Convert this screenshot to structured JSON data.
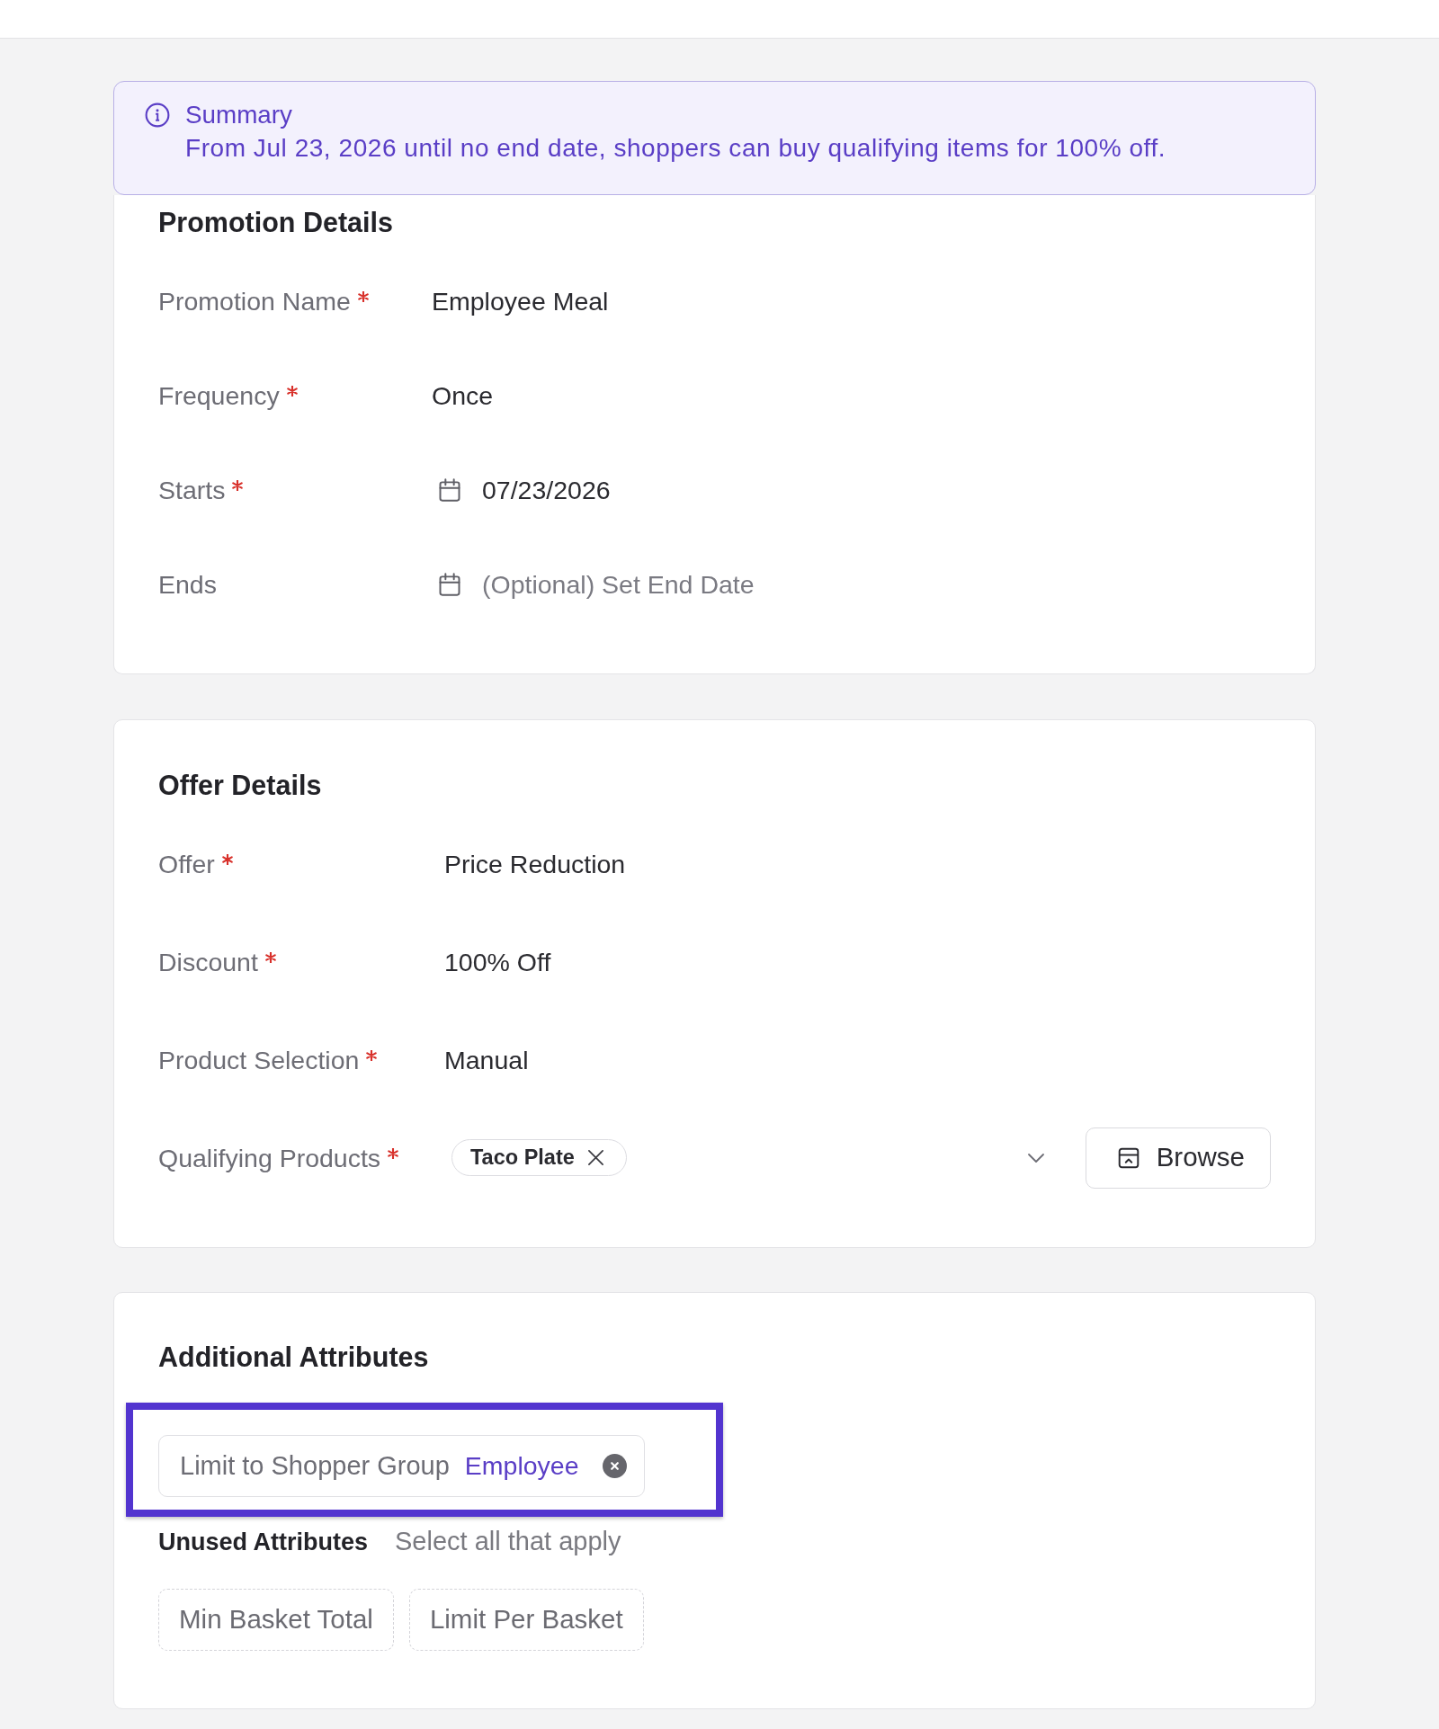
{
  "summary": {
    "title": "Summary",
    "text": "From Jul 23, 2026 until no end date, shoppers can buy qualifying items for 100% off."
  },
  "sections": [
    {
      "title": "Promotion Details",
      "fields": [
        {
          "kind": "text",
          "label": "Promotion Name",
          "required": true,
          "value": "Employee Meal"
        },
        {
          "kind": "text",
          "label": "Frequency",
          "required": true,
          "value": "Once"
        },
        {
          "kind": "date",
          "label": "Starts",
          "required": true,
          "value": "07/23/2026"
        },
        {
          "kind": "date",
          "label": "Ends",
          "required": false,
          "placeholder": "(Optional) Set End Date"
        }
      ]
    },
    {
      "title": "Offer Details",
      "fields": [
        {
          "kind": "text",
          "label": "Offer",
          "required": true,
          "value": "Price Reduction"
        },
        {
          "kind": "text",
          "label": "Discount",
          "required": true,
          "value": "100% Off"
        },
        {
          "kind": "text",
          "label": "Product Selection",
          "required": true,
          "value": "Manual"
        },
        {
          "kind": "products",
          "label": "Qualifying Products",
          "required": true,
          "tags": [
            "Taco Plate"
          ],
          "button": "Browse"
        }
      ]
    }
  ],
  "additional_attributes": {
    "title": "Additional Attributes",
    "applied": [
      {
        "name": "Limit to Shopper Group",
        "value": "Employee",
        "highlighted": true
      }
    ],
    "unused_title": "Unused Attributes",
    "unused_hint": "Select all that apply",
    "unused": [
      "Min Basket Total",
      "Limit Per Basket"
    ]
  }
}
